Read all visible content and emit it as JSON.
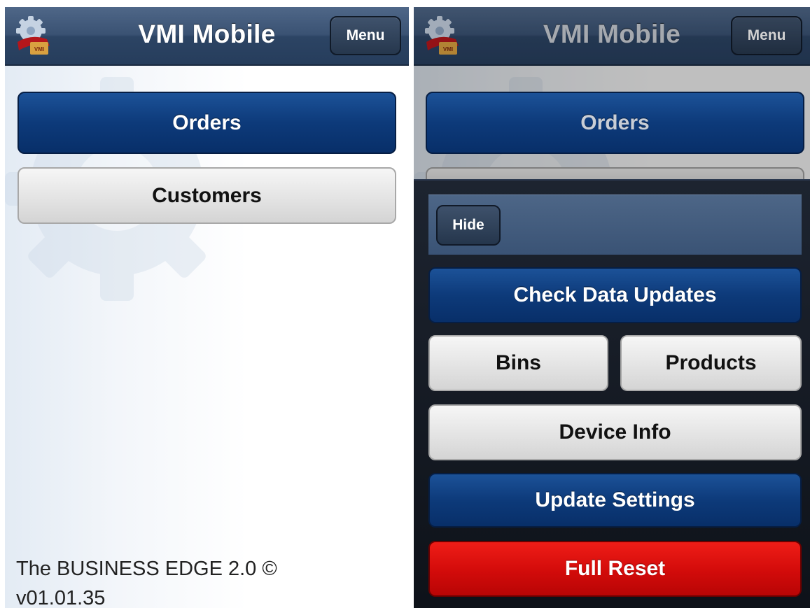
{
  "left_screen": {
    "header": {
      "title": "VMI Mobile",
      "menu_label": "Menu",
      "logo_text": "VMI"
    },
    "buttons": {
      "orders": "Orders",
      "customers": "Customers"
    },
    "footer": {
      "line1": "The BUSINESS EDGE 2.0 ©",
      "line2": "v01.01.35"
    }
  },
  "right_screen": {
    "header": {
      "title": "VMI Mobile",
      "menu_label": "Menu",
      "logo_text": "VMI"
    },
    "buttons": {
      "orders": "Orders"
    },
    "menu_panel": {
      "hide_label": "Hide",
      "check_data_updates": "Check Data Updates",
      "bins": "Bins",
      "products": "Products",
      "device_info": "Device Info",
      "update_settings": "Update Settings",
      "full_reset": "Full Reset"
    }
  },
  "icons": [
    "gear-logo-icon",
    "background-gear-icon"
  ],
  "colors": {
    "header": "#2c4464",
    "primary_button": "#0d3a7a",
    "secondary_button": "#e2e2e2",
    "danger_button": "#d20b0a",
    "menu_panel": "#1d2430"
  }
}
